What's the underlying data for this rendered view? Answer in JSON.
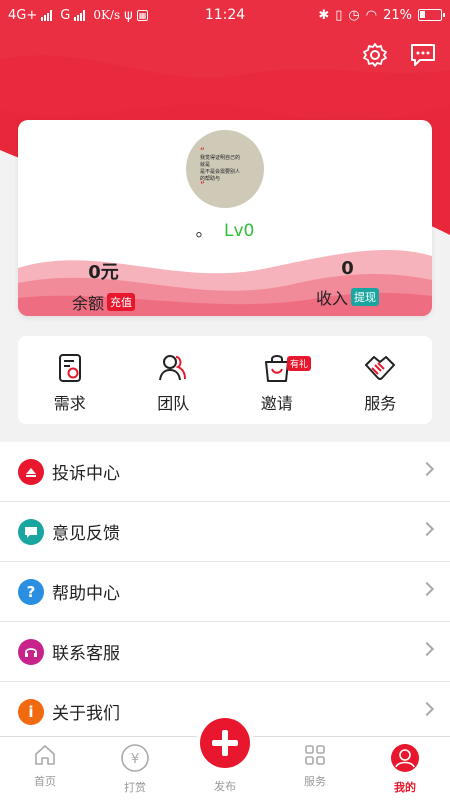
{
  "status_bar": {
    "network_1": "4G+",
    "network_2": "G",
    "speed": "0K/s",
    "time": "11:24",
    "battery": "21%"
  },
  "header": {
    "settings_icon": "gear-icon",
    "message_icon": "message-icon"
  },
  "profile": {
    "avatar_text": [
      "“",
      "我觉得证明自己的",
      "就是",
      "是不是会需要别人",
      "的帮助与",
      "”"
    ],
    "nickname": "。",
    "level": "Lv0",
    "balance_value": "0元",
    "balance_label": "余额",
    "recharge_badge": "充值",
    "income_value": "0",
    "income_label": "收入",
    "withdraw_badge": "提现"
  },
  "quick_actions": [
    {
      "label": "需求",
      "icon": "demand-icon"
    },
    {
      "label": "团队",
      "icon": "team-icon"
    },
    {
      "label": "邀请",
      "icon": "invite-bag-icon",
      "badge": "有礼"
    },
    {
      "label": "服务",
      "icon": "handshake-icon"
    }
  ],
  "menu": [
    {
      "label": "投诉中心",
      "icon": "complaint-icon",
      "color": "#e8172d"
    },
    {
      "label": "意见反馈",
      "icon": "feedback-icon",
      "color": "#1aa6a0"
    },
    {
      "label": "帮助中心",
      "icon": "help-icon",
      "color": "#2a8fe0"
    },
    {
      "label": "联系客服",
      "icon": "headset-icon",
      "color": "#c8238a"
    },
    {
      "label": "关于我们",
      "icon": "info-icon",
      "color": "#f26a10"
    }
  ],
  "tabbar": {
    "home": "首页",
    "reward": "打赏",
    "publish": "发布",
    "service": "服务",
    "mine": "我的"
  },
  "colors": {
    "brand_red": "#e8172d",
    "teal": "#1aa6a0",
    "level_green": "#2fbf3a"
  }
}
